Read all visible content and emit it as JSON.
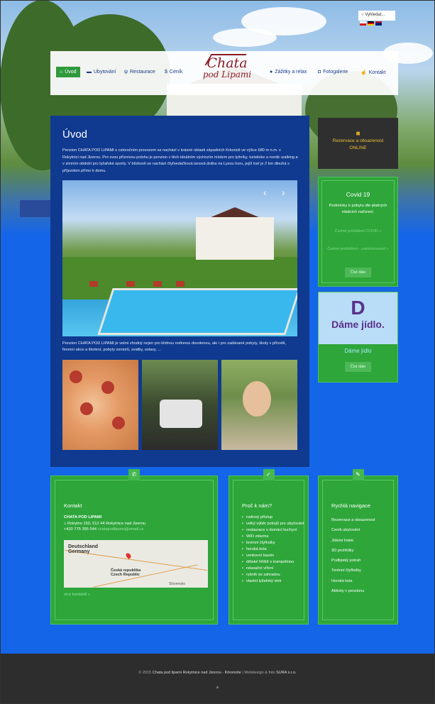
{
  "header": {
    "search_placeholder": "Vyhledat...",
    "languages": [
      {
        "code": "cs",
        "colors": [
          "#ffffff",
          "#d7141a",
          "#11457e"
        ]
      },
      {
        "code": "de",
        "colors": [
          "#000000",
          "#dd0000",
          "#ffce00"
        ]
      },
      {
        "code": "en",
        "colors": [
          "#012169",
          "#c8102e",
          "#ffffff"
        ]
      }
    ]
  },
  "nav": {
    "items": [
      {
        "label": "Úvod",
        "icon": "home-icon",
        "active": true
      },
      {
        "label": "Ubytování",
        "icon": "bed-icon",
        "active": false
      },
      {
        "label": "Restaurace",
        "icon": "restaurant-icon",
        "active": false
      },
      {
        "label": "Ceník",
        "icon": "dollar-icon",
        "active": false
      },
      {
        "label": "Zážitky a relax",
        "icon": "leaf-icon",
        "active": false
      },
      {
        "label": "Fotogalerie",
        "icon": "camera-icon",
        "active": false
      },
      {
        "label": "Kontakt",
        "icon": "thumbs-up-icon",
        "active": false
      }
    ],
    "logo_line1": "Chata",
    "logo_line2": "pod Lipami"
  },
  "main": {
    "title": "Úvod",
    "intro": "Penzion CHATA POD LIPAMI s celoročním provozem se nachází v krásné oblasti západních Krkonoš ve výšce 680 m n.m. v Rokytnici nad Jizerou. Pro svou příznivou polohu je penzion v těch ideálním výchozím místem pro lyžníky, turisticke a nordic walking a v zimním období pro lyžařské sporty. V blízkosti se nachází čtyřsedačková lanová dráha na Lysou horu, jejíž trať je 2 km dlouhá s příjezdem přímo k domu.",
    "slider_prev": "‹",
    "slider_next": "›",
    "summary": "Penzion CHATA POD LIPAMI je velmi vhodný nejen pro klidnou rodinnou dovolenou, ale i pro zadávané pobyty, školy v přírodě, firemní akce a školení, pobyty seniorů, svatby, oslavy, ..."
  },
  "sidebar": {
    "reservation_line1": "Rezervace a obsazenost",
    "reservation_line2": "ONLINE",
    "covid": {
      "title": "Covid 19",
      "text": "Podmínky k pobytu dle platných vládních nařízení.",
      "link1": "Čestné prohlášení COVID »",
      "link2": "Čestné prohlášení - zaměstnavatel »",
      "button": "Číst dále"
    },
    "dame": {
      "logo_letter": "D",
      "logo_text": "Dáme jídlo.",
      "title": "Dáme jídlo",
      "button": "Číst dále"
    }
  },
  "contact": {
    "title": "Kontakt",
    "name": "CHATA POD LIPAMI",
    "address": "Rokytno 160, 512 44 Rokytnice nad Jizerou",
    "phone": "+420 775 355 044",
    "email": "chatapodlipami@email.cz",
    "map_label_de1": "Deutschland",
    "map_label_de2": "Germany",
    "map_label_cz1": "Česká republika",
    "map_label_cz2": "Czech Republic",
    "map_label_sk": "Slovensko",
    "more": "více kontaktů »"
  },
  "why": {
    "title": "Proč k nám?",
    "items": [
      "rodinný přístup",
      "velký výběr pokojů pro ubytování",
      "restaurace s domácí kuchyní",
      "WiFi zdarma",
      "terénní čtyřkolky",
      "horská kola",
      "venkovní bazén",
      "dětské hřiště s trampolínou",
      "relaxační víření",
      "rybník se zahradou",
      "vlastní lyžařský vlek"
    ]
  },
  "quick": {
    "title": "Rychlá navigace",
    "items": [
      "Rezervace a obsazenost",
      "Ceník ubytování",
      "Jídelní lístek",
      "3D prohlídky",
      "Podlipský potrah",
      "Terénní čtyřkolky",
      "Horská kola",
      "Aktivity v penzionu"
    ]
  },
  "footer": {
    "copyright": "© 2015 ",
    "site": "Chata pod lipami Rokytnice nad Jizerou - Krkonoše",
    "sep": " | Webdesign & foto ",
    "author": "SURA s.r.o.",
    "up": "▲"
  }
}
